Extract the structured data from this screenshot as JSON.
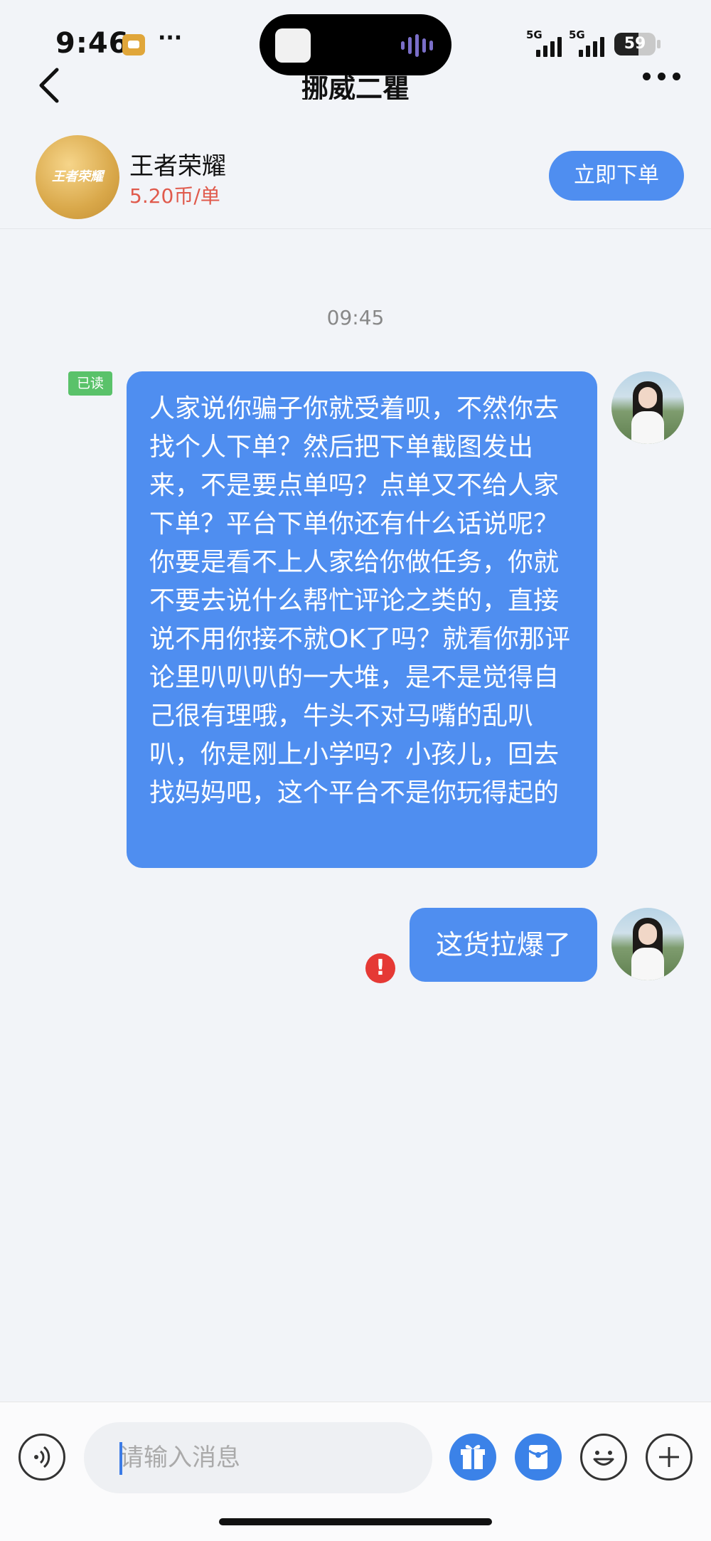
{
  "status_bar": {
    "time": "9:46",
    "dots": "···",
    "network_1": "5G",
    "network_2": "5G",
    "battery": "59"
  },
  "nav": {
    "title": "挪威二瞿"
  },
  "game": {
    "logo_text": "王者荣耀",
    "name": "王者荣耀",
    "price": "5.20币/单",
    "order_button": "立即下单"
  },
  "chat": {
    "timestamp": "09:45",
    "read_badge": "已读",
    "messages": [
      {
        "text": "人家说你骗子你就受着呗，不然你去找个人下单？然后把下单截图发出来，不是要点单吗？点单又不给人家下单？平台下单你还有什么话说呢？你要是看不上人家给你做任务，你就不要去说什么帮忙评论之类的，直接说不用你接不就OK了吗？就看你那评论里叭叭叭的一大堆，是不是觉得自己很有理哦，牛头不对马嘴的乱叭叭，你是刚上小学吗？小孩儿，回去找妈妈吧，这个平台不是你玩得起的"
      },
      {
        "text": "这货拉爆了"
      }
    ],
    "error_mark": "!"
  },
  "input": {
    "placeholder": "请输入消息"
  },
  "colors": {
    "accent": "#4f8ef0",
    "price": "#e05a4c",
    "read_badge": "#5ac26a",
    "error": "#e53935"
  },
  "icons": [
    "back-icon",
    "more-icon",
    "voice-icon",
    "gift-icon",
    "red-packet-icon",
    "emoji-icon",
    "plus-icon"
  ]
}
